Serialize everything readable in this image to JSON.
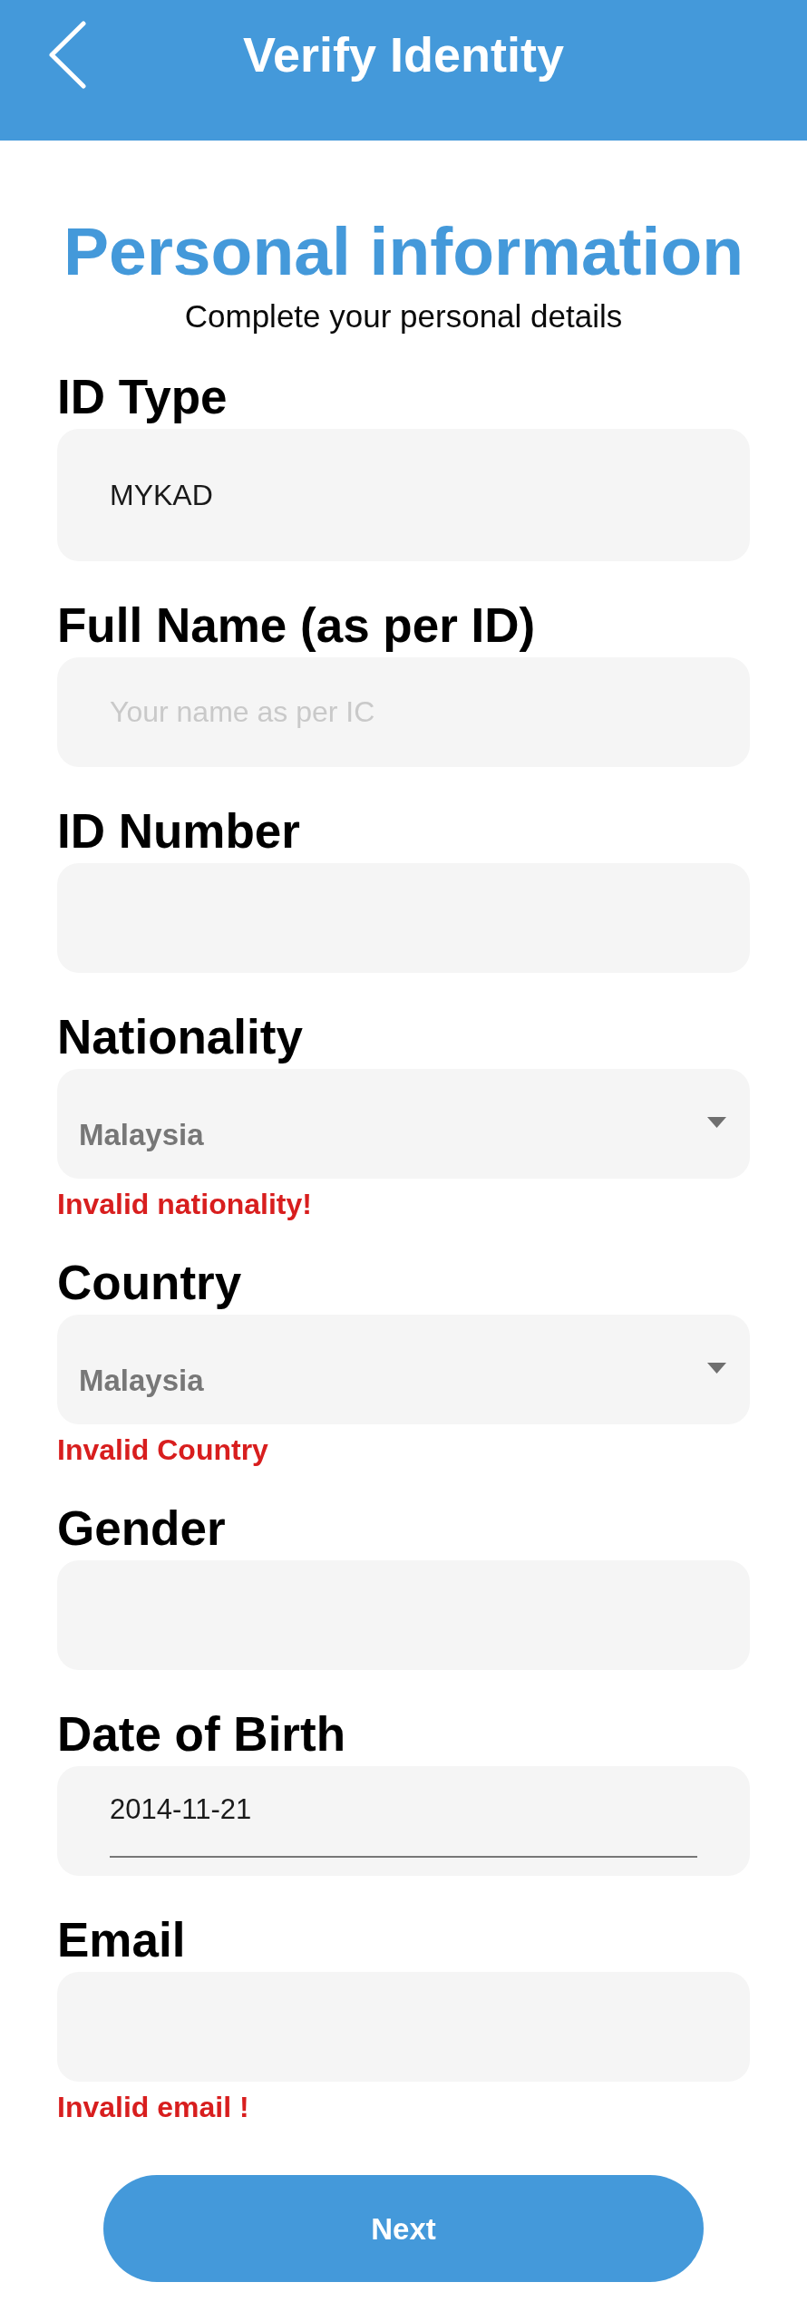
{
  "header": {
    "title": "Verify Identity"
  },
  "intro": {
    "title": "Personal information",
    "subtitle": "Complete your personal details"
  },
  "fields": [
    {
      "kind": "readonly",
      "label": "ID Type",
      "value": "MYKAD"
    },
    {
      "kind": "text",
      "label": "Full Name (as per ID)",
      "placeholder": "Your name as per IC"
    },
    {
      "kind": "text",
      "label": "ID Number"
    },
    {
      "kind": "dropdown",
      "label": "Nationality",
      "placeholder": "Malaysia",
      "error": "Invalid nationality!"
    },
    {
      "kind": "dropdown",
      "label": "Country",
      "placeholder": "Malaysia",
      "error": "Invalid Country"
    },
    {
      "kind": "text",
      "label": "Gender"
    },
    {
      "kind": "date",
      "label": "Date of Birth",
      "value": "2014-11-21"
    },
    {
      "kind": "text",
      "label": "Email",
      "error": "Invalid email !"
    }
  ],
  "next_button": {
    "label": "Next"
  }
}
